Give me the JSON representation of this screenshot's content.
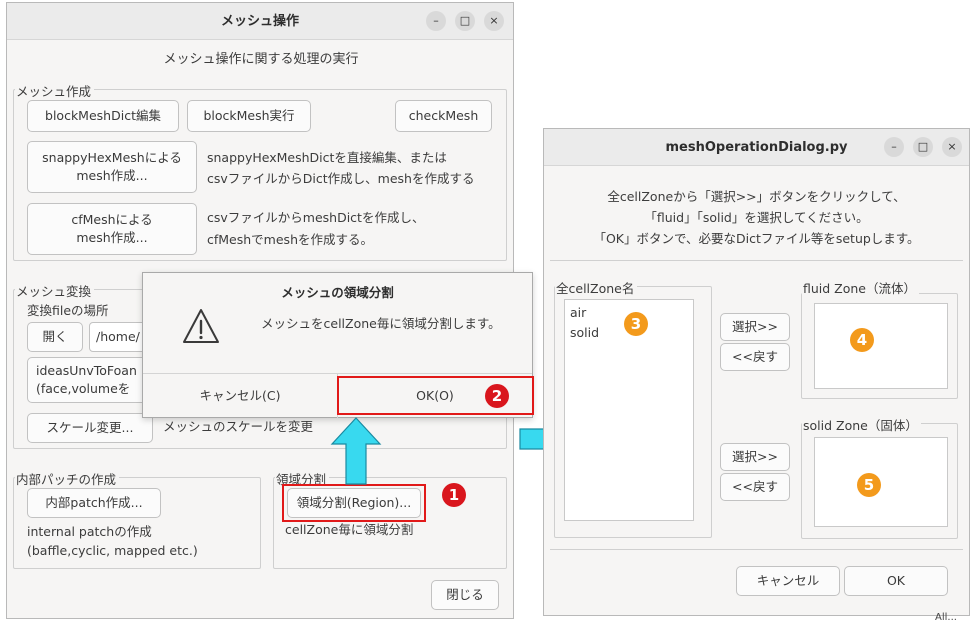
{
  "left_window": {
    "title": "メッシュ操作",
    "heading": "メッシュ操作に関する処理の実行",
    "mesh_create": {
      "legend": "メッシュ作成",
      "blockmeshdict_edit": "blockMeshDict編集",
      "blockmesh_run": "blockMesh実行",
      "checkmesh": "checkMesh",
      "snappy_button_l1": "snappyHexMeshによる",
      "snappy_button_l2": "mesh作成...",
      "snappy_desc_l1": "snappyHexMeshDictを直接編集、または",
      "snappy_desc_l2": "csvファイルからDict作成し、meshを作成する",
      "cfmesh_button_l1": "cfMeshによる",
      "cfmesh_button_l2": "mesh作成...",
      "cfmesh_desc_l1": "csvファイルからmeshDictを作成し、",
      "cfmesh_desc_l2": "cfMeshでmeshを作成する。"
    },
    "mesh_convert": {
      "legend": "メッシュ変換",
      "file_location": "変換fileの場所",
      "open_button": "開く",
      "path_value": "/home/",
      "ideas_l1": "ideasUnvToFoan",
      "ideas_l2": "(face,volumeを",
      "scale_button": "スケール変更...",
      "scale_desc": "メッシュのスケールを変更"
    },
    "internal_patch": {
      "legend": "内部パッチの作成",
      "button": "内部patch作成...",
      "desc_l1": "internal patchの作成",
      "desc_l2": "(baffle,cyclic, mapped etc.)"
    },
    "region": {
      "legend": "領域分割",
      "button": "領域分割(Region)...",
      "desc": "cellZone毎に領域分割"
    },
    "close_button": "閉じる"
  },
  "confirm_dialog": {
    "title": "メッシュの領域分割",
    "message": "メッシュをcellZone毎に領域分割します。",
    "cancel_button": "キャンセル(C)",
    "ok_button": "OK(O)",
    "icon": "warning-icon"
  },
  "right_window": {
    "title": "meshOperationDialog.py",
    "instruction_l1": "全cellZoneから「選択>>」ボタンをクリックして、",
    "instruction_l2": "「fluid」「solid」を選択してください。",
    "instruction_l3": "「OK」ボタンで、必要なDictファイル等をsetupします。",
    "all_zones_legend": "全cellZone名",
    "all_zones": [
      "air",
      "solid"
    ],
    "select_button": "選択>>",
    "back_button": "<<戻す",
    "fluid_legend": "fluid Zone（流体）",
    "solid_legend": "solid Zone（固体）",
    "cancel_button": "キャンセル",
    "ok_button": "OK"
  },
  "markers": [
    "1",
    "2",
    "3",
    "4",
    "5"
  ],
  "window_controls": {
    "minimize": "–",
    "maximize": "□",
    "close": "×"
  },
  "background_snippet": "All... ",
  "colors": {
    "marker_red": "#d9161d",
    "marker_orange": "#f39a1c",
    "arrow_cyan": "#38d9ef",
    "highlight_red": "#e11919"
  }
}
